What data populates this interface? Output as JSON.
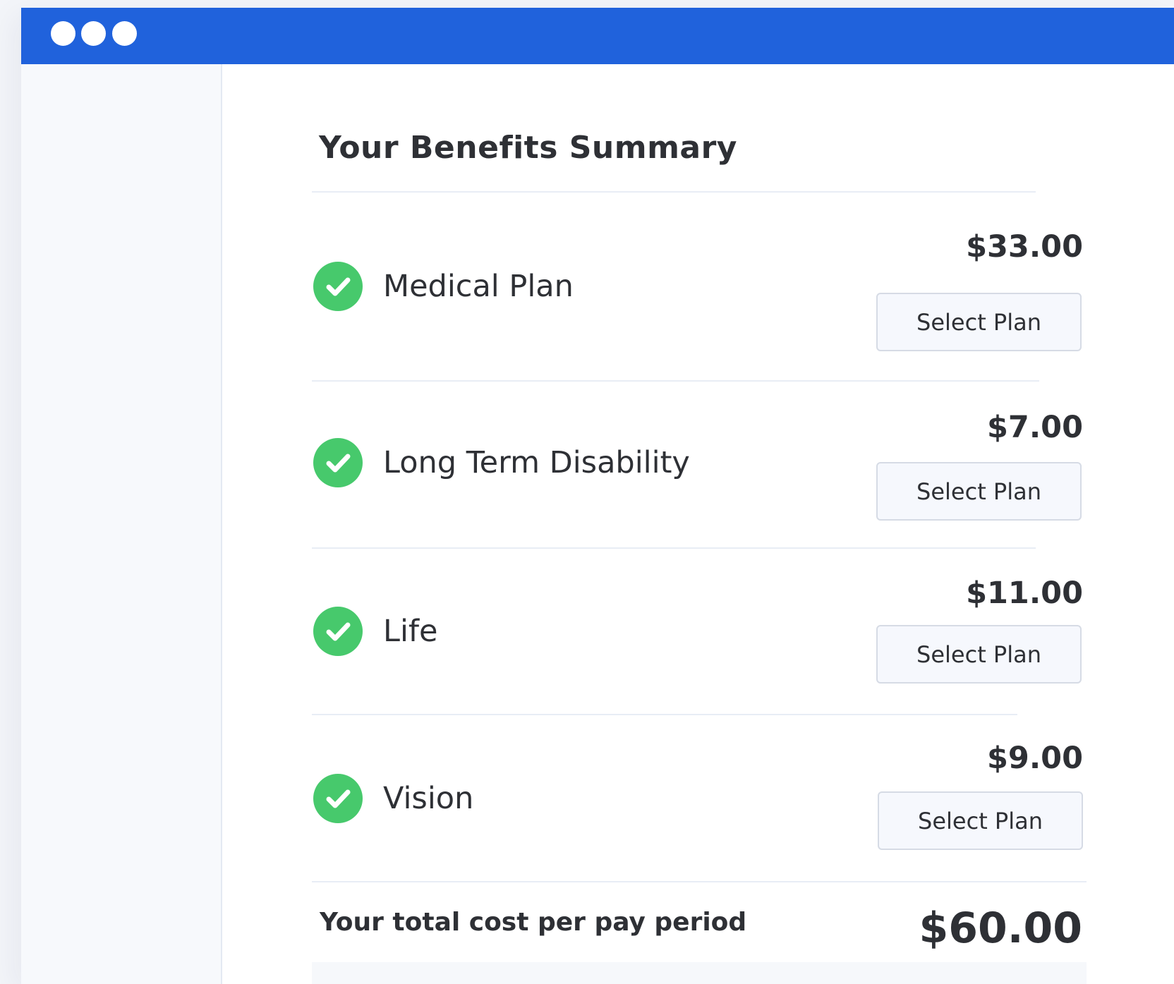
{
  "summary": {
    "title": "Your Benefits Summary",
    "total_label": "Your total cost per pay period",
    "total_value": "$60.00"
  },
  "benefits": [
    {
      "name": "Medical Plan",
      "price": "$33.00",
      "button_label": "Select Plan",
      "status": "selected"
    },
    {
      "name": "Long Term Disability",
      "price": "$7.00",
      "button_label": "Select Plan",
      "status": "selected"
    },
    {
      "name": "Life",
      "price": "$11.00",
      "button_label": "Select Plan",
      "status": "selected"
    },
    {
      "name": "Vision",
      "price": "$9.00",
      "button_label": "Select Plan",
      "status": "selected"
    }
  ],
  "colors": {
    "titlebar": "#2062dc",
    "check": "#47c96c",
    "text": "#2e3035",
    "button_bg": "#f6f8fd",
    "button_border": "#d6dbe5"
  },
  "icons": {
    "window_controls": "window-dot-icon",
    "benefit_status": "check-circle-icon"
  }
}
